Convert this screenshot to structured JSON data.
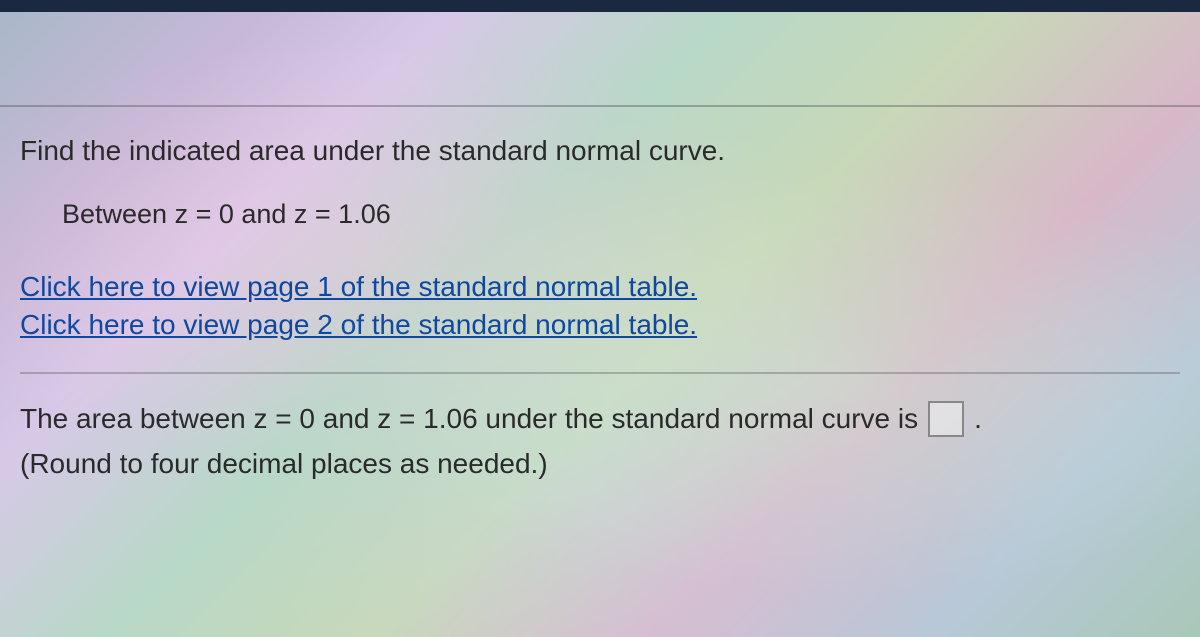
{
  "question": {
    "title": "Find the indicated area under the standard normal curve.",
    "condition": "Between z = 0 and z = 1.06"
  },
  "links": {
    "page1": "Click here to view page 1 of the standard normal table.",
    "page2": "Click here to view page 2 of the standard normal table."
  },
  "answer": {
    "prefix": "The area between z = 0 and z = 1.06 under the standard normal curve is",
    "suffix": ".",
    "input_value": "",
    "round_note": "(Round to four decimal places as needed.)"
  }
}
